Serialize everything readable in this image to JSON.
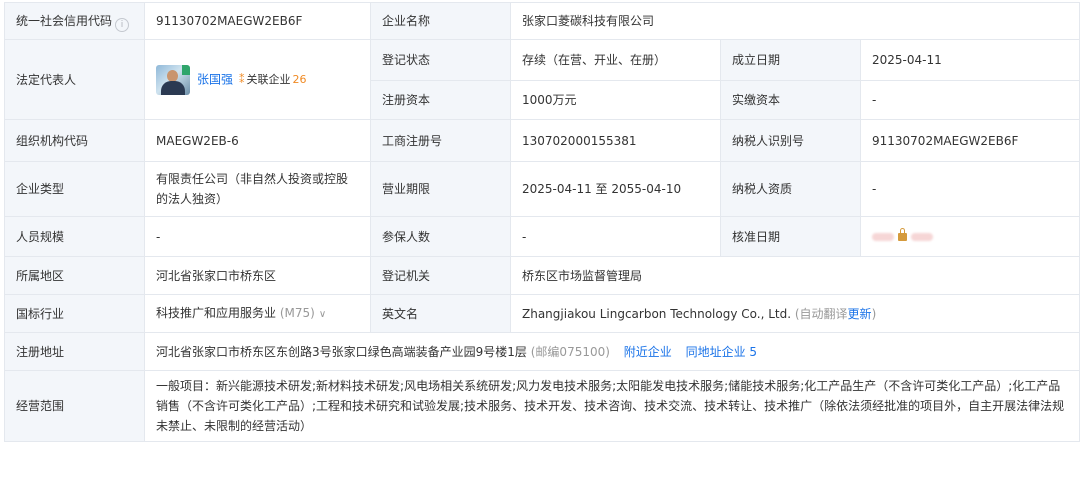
{
  "rows": {
    "credit_code": {
      "label": "统一社会信用代码",
      "value": "91130702MAEGW2EB6F",
      "name_label": "企业名称",
      "name_value": "张家口菱碳科技有限公司"
    },
    "legal_rep": {
      "label": "法定代表人",
      "person": "张国强",
      "related_label": "关联企业",
      "related_count": "26",
      "status_label": "登记状态",
      "status_value": "存续（在营、开业、在册）",
      "founded_label": "成立日期",
      "founded_value": "2025-04-11",
      "reg_capital_label": "注册资本",
      "reg_capital_value": "1000万元",
      "paid_capital_label": "实缴资本",
      "paid_capital_value": "-"
    },
    "org_code": {
      "label": "组织机构代码",
      "value": "MAEGW2EB-6",
      "reg_no_label": "工商注册号",
      "reg_no_value": "130702000155381",
      "taxpayer_label": "纳税人识别号",
      "taxpayer_value": "91130702MAEGW2EB6F"
    },
    "company_type": {
      "label": "企业类型",
      "value": "有限责任公司（非自然人投资或控股的法人独资）",
      "term_label": "营业期限",
      "term_value": "2025-04-11 至 2055-04-10",
      "tax_qual_label": "纳税人资质",
      "tax_qual_value": "-"
    },
    "staff": {
      "label": "人员规模",
      "value": "-",
      "insured_label": "参保人数",
      "insured_value": "-",
      "approval_label": "核准日期"
    },
    "region": {
      "label": "所属地区",
      "value": "河北省张家口市桥东区",
      "authority_label": "登记机关",
      "authority_value": "桥东区市场监督管理局"
    },
    "industry": {
      "label": "国标行业",
      "value": "科技推广和应用服务业",
      "code": "(M75)",
      "en_label": "英文名",
      "en_value": "Zhangjiakou Lingcarbon Technology Co., Ltd.",
      "auto_translate": "(自动翻译",
      "update": "更新",
      "close_paren": ")"
    },
    "address": {
      "label": "注册地址",
      "value": "河北省张家口市桥东区东创路3号张家口绿色高端装备产业园9号楼1层",
      "postal": "(邮编075100)",
      "nearby": "附近企业",
      "same_addr": "同地址企业 5"
    },
    "scope": {
      "label": "经营范围",
      "value": "一般项目：新兴能源技术研发;新材料技术研发;风电场相关系统研发;风力发电技术服务;太阳能发电技术服务;储能技术服务;化工产品生产（不含许可类化工产品）;化工产品销售（不含许可类化工产品）;工程和技术研究和试验发展;技术服务、技术开发、技术咨询、技术交流、技术转让、技术推广（除依法须经批准的项目外，自主开展法律法规未禁止、未限制的经营活动）"
    }
  },
  "icons": {
    "info": "info-icon",
    "chevron": "chevron-down-icon",
    "lock": "lock-icon",
    "related": "related-companies-icon"
  },
  "colors": {
    "label_bg": "#f3f6fa",
    "border": "#e4e8ee",
    "link": "#1a73e8",
    "accent": "#f08a24"
  }
}
